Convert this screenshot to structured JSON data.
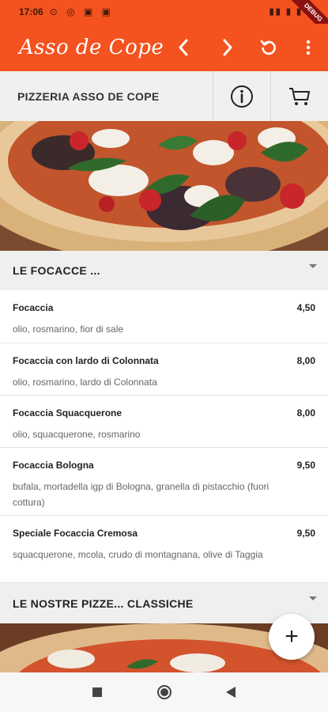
{
  "status_bar": {
    "time": "17:06",
    "debug_label": "DEBUG"
  },
  "app_bar": {
    "logo_text": "Asso de Cope",
    "back_icon": "chevron-left-icon",
    "forward_icon": "chevron-right-icon",
    "refresh_icon": "refresh-icon",
    "menu_icon": "more-vert-icon",
    "color": "#f4521e"
  },
  "restaurant": {
    "name": "PIZZERIA ASSO DE COPE",
    "info_icon": "info-icon",
    "cart_icon": "cart-icon"
  },
  "sections": [
    {
      "title": "LE FOCACCE ...",
      "items": [
        {
          "name": "Focaccia",
          "price": "4,50",
          "description": "olio, rosmarino, fior di sale"
        },
        {
          "name": "Focaccia con lardo di Colonnata",
          "price": "8,00",
          "description": "olio, rosmarino, lardo di Colonnata"
        },
        {
          "name": "Focaccia Squacquerone",
          "price": "8,00",
          "description": "olio, squacquerone, rosmarino"
        },
        {
          "name": "Focaccia Bologna",
          "price": "9,50",
          "description": "bufala, mortadella igp di Bologna, granella di pistacchio (fuori cottura)"
        },
        {
          "name": "Speciale Focaccia Cremosa",
          "price": "9,50",
          "description": "squacquerone, mcola, crudo di montagnana, olive di Taggia"
        }
      ]
    },
    {
      "title": "LE NOSTRE PIZZE... CLASSICHE",
      "items": []
    }
  ],
  "fab": {
    "label": "+"
  }
}
